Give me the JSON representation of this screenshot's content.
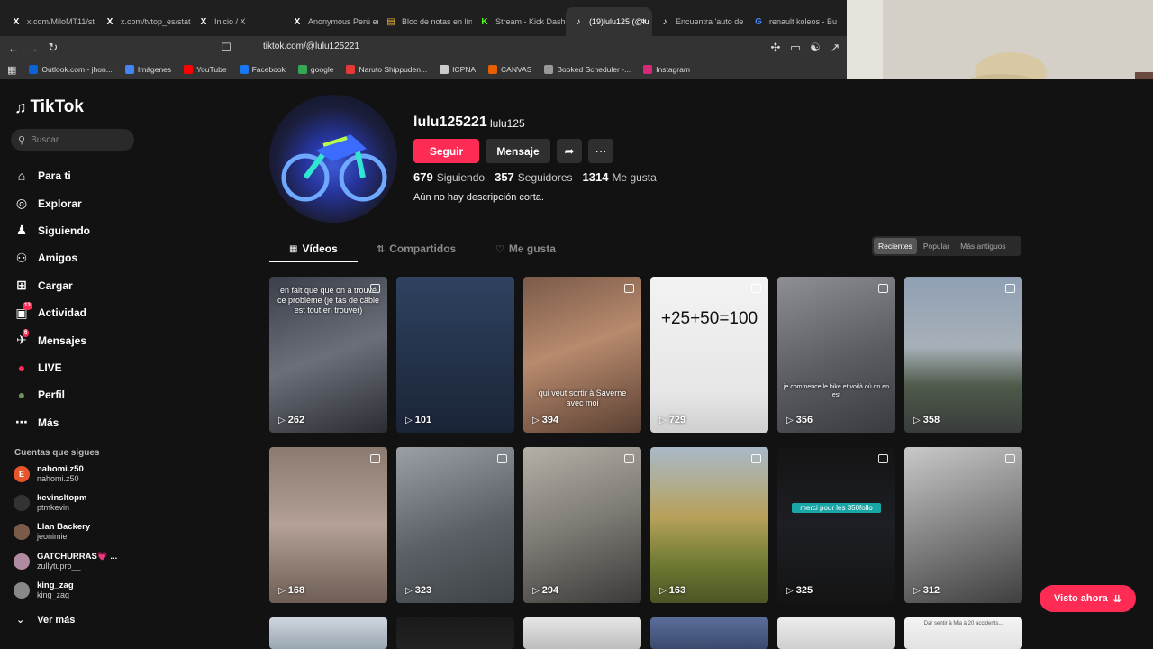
{
  "browser": {
    "tabs": [
      {
        "icon": "x-icon",
        "title": "x.com/MiloMT11/st"
      },
      {
        "icon": "x-icon",
        "title": "x.com/tvtop_es/stat"
      },
      {
        "icon": "x-icon",
        "title": "Inicio / X"
      },
      {
        "icon": "x-icon",
        "title": "Anonymous Perú en"
      },
      {
        "icon": "notepad-icon",
        "title": "Bloc de notas en lín"
      },
      {
        "icon": "kick-icon",
        "title": "Stream - Kick Dashb"
      },
      {
        "icon": "tiktok-icon",
        "title": "(19)lulu125 (@lu"
      },
      {
        "icon": "tiktok-icon",
        "title": "Encuentra 'auto de"
      },
      {
        "icon": "google-icon",
        "title": "renault koleos - Bu"
      }
    ],
    "url": "tiktok.com/@lulu125221",
    "bookmarks": [
      {
        "label": "Outlook.com - jhon...",
        "color": "#0a64d6"
      },
      {
        "label": "Imágenes",
        "color": "#4285f4"
      },
      {
        "label": "YouTube",
        "color": "#ff0000"
      },
      {
        "label": "Facebook",
        "color": "#1877f2"
      },
      {
        "label": "google",
        "color": "#34a853"
      },
      {
        "label": "Naruto Shippuden...",
        "color": "#e53935"
      },
      {
        "label": "ICPNA",
        "color": "#cccccc"
      },
      {
        "label": "CANVAS",
        "color": "#e66000"
      },
      {
        "label": "Booked Scheduler -...",
        "color": "#999999"
      },
      {
        "label": "Instagram",
        "color": "#d62976"
      }
    ]
  },
  "sidebar": {
    "logo": "TikTok",
    "search_placeholder": "Buscar",
    "items": [
      {
        "icon": "home-icon",
        "label": "Para ti"
      },
      {
        "icon": "compass-icon",
        "label": "Explorar"
      },
      {
        "icon": "following-icon",
        "label": "Siguiendo"
      },
      {
        "icon": "friends-icon",
        "label": "Amigos"
      },
      {
        "icon": "upload-icon",
        "label": "Cargar"
      },
      {
        "icon": "activity-icon",
        "label": "Actividad",
        "badge": "13"
      },
      {
        "icon": "messages-icon",
        "label": "Mensajes",
        "badge": "6"
      },
      {
        "icon": "live-icon",
        "label": "LIVE"
      },
      {
        "icon": "profile-icon",
        "label": "Perfil"
      },
      {
        "icon": "more-icon",
        "label": "Más"
      }
    ],
    "following_title": "Cuentas que sigues",
    "following": [
      {
        "name": "nahomi.z50",
        "sub": "nahomi.z50",
        "avatar": "E",
        "color": "#e8542c"
      },
      {
        "name": "kevinsltopm",
        "sub": "ptmkevin",
        "avatar": "",
        "color": "#333333"
      },
      {
        "name": "Llan Backery",
        "sub": "jeonimie",
        "avatar": "",
        "color": "#7a5b4a"
      },
      {
        "name": "GATCHURRAS💗 ...",
        "sub": "zullytupro__",
        "avatar": "",
        "color": "#b08aa0"
      },
      {
        "name": "king_zag",
        "sub": "king_zag",
        "avatar": "",
        "color": "#888888"
      }
    ],
    "see_more": "Ver más"
  },
  "profile": {
    "username": "lulu125221",
    "nickname": "lulu125",
    "follow_label": "Seguir",
    "message_label": "Mensaje",
    "following_count": "679",
    "following_label": "Siguiendo",
    "followers_count": "357",
    "followers_label": "Seguidores",
    "likes_count": "1314",
    "likes_label": "Me gusta",
    "bio": "Aún no hay descripción corta."
  },
  "content_tabs": {
    "videos": "Vídeos",
    "reposts": "Compartidos",
    "liked": "Me gusta",
    "sort": [
      "Recientes",
      "Popular",
      "Más antiguos"
    ]
  },
  "videos": [
    {
      "views": "262",
      "caption": "en fait que que on a trouvé ce problème (je tas de câble est tout en trouver)",
      "bg": "linear-gradient(160deg,#3b3f4a,#6b6f78 50%,#2b2d33)"
    },
    {
      "views": "101",
      "caption": "",
      "bg": "linear-gradient(180deg,#2f4260,#223047 60%,#1a2437)"
    },
    {
      "views": "394",
      "caption": "qui veut sortir à Saverne avec moi",
      "bg": "linear-gradient(160deg,#7a5a48,#b88a6e 45%,#5a4032)"
    },
    {
      "views": "729",
      "caption": "+25+50=100",
      "bg": "linear-gradient(180deg,#f3f3f3,#e6e6e6 75%,#cfcfcf)"
    },
    {
      "views": "356",
      "caption": "je commence le bike et voilà où on en est",
      "bg": "linear-gradient(160deg,#8d8f95,#5a5c62 55%,#3a3b40)"
    },
    {
      "views": "358",
      "caption": "",
      "bg": "linear-gradient(180deg,#8fa0b4,#a7b0b8 45%,#4f5a4a 70%,#383c3c)"
    },
    {
      "views": "168",
      "caption": "",
      "bg": "linear-gradient(180deg,#8a7a70,#b4a095 50%,#6e5e55)"
    },
    {
      "views": "323",
      "caption": "",
      "bg": "linear-gradient(160deg,#9aa0a6,#5b6066 55%,#3e4347)"
    },
    {
      "views": "294",
      "caption": "",
      "bg": "linear-gradient(160deg,#b5b0a7,#7d7a74 50%,#3b3a38)"
    },
    {
      "views": "163",
      "caption": "",
      "bg": "linear-gradient(180deg,#a9b9c9,#b7a15a 45%,#6f7a32 75%,#4d5426)"
    },
    {
      "views": "325",
      "caption": "merci pour les 350follo",
      "bg": "linear-gradient(180deg,#141414,#1d1f24 50%,#141414)"
    },
    {
      "views": "312",
      "caption": "",
      "bg": "linear-gradient(160deg,#c9c9c9,#8a8a8a 45%,#3f3f3f)"
    },
    {
      "views": "",
      "caption": "",
      "bg": "linear-gradient(180deg,#cfd6de,#9aa6b2)"
    },
    {
      "views": "",
      "caption": "",
      "bg": "linear-gradient(180deg,#1a1a1a,#222)"
    },
    {
      "views": "",
      "caption": "",
      "bg": "linear-gradient(180deg,#e6e6e6,#bdbdbd)"
    },
    {
      "views": "",
      "caption": "",
      "bg": "linear-gradient(180deg,#5a6e9a,#3a4a6e)"
    },
    {
      "views": "",
      "caption": "",
      "bg": "linear-gradient(180deg,#ececec,#cfcfcf)"
    },
    {
      "views": "",
      "caption": "Dar sentir à Mia à 20 accidents...",
      "bg": "linear-gradient(180deg,#f4f4f4,#e2e2e2)"
    }
  ],
  "watched_label": "Visto ahora",
  "colors": {
    "accent": "#fe2c55",
    "bg": "#121212"
  }
}
